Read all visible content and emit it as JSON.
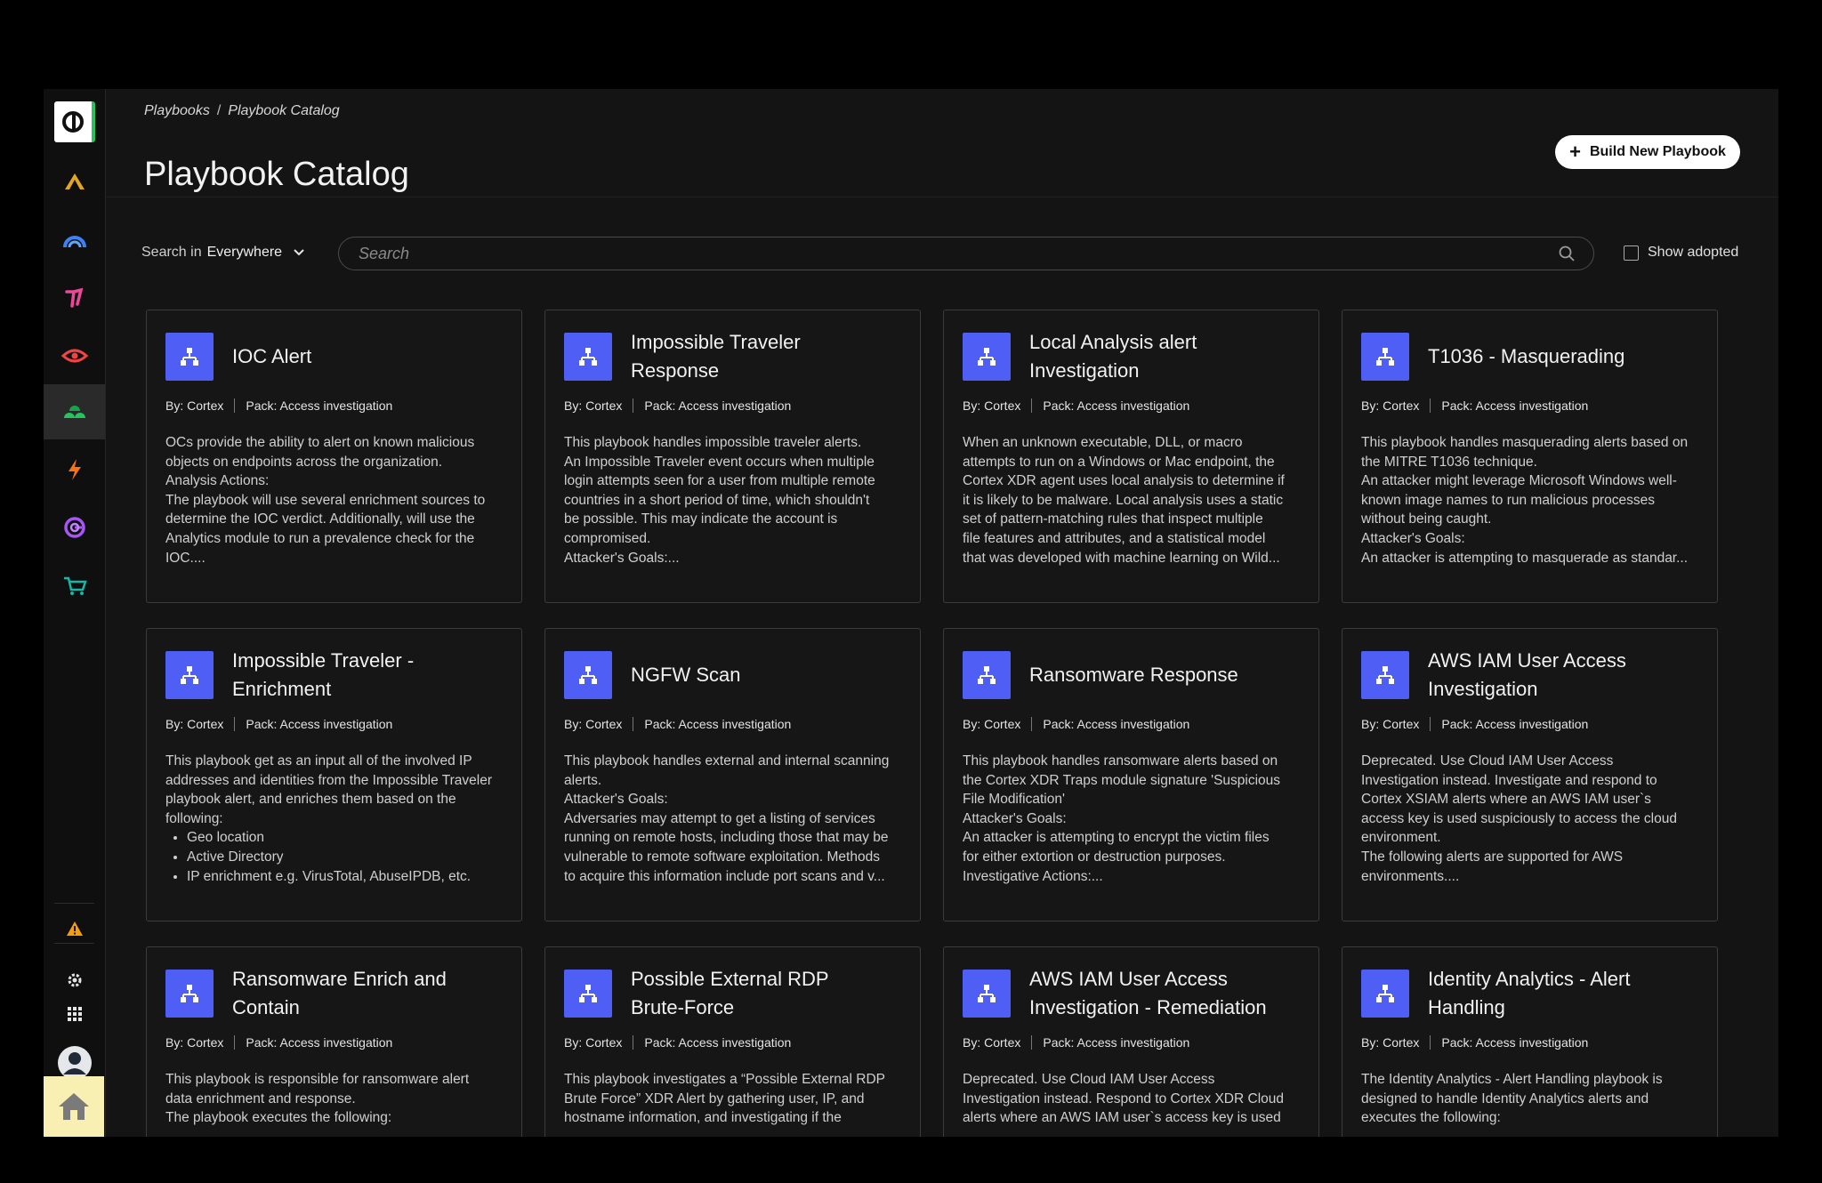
{
  "breadcrumb": {
    "root": "Playbooks",
    "current": "Playbook Catalog"
  },
  "page": {
    "title": "Playbook Catalog",
    "build_label": "Build New Playbook"
  },
  "filter": {
    "search_in_label": "Search in",
    "search_in_value": "Everywhere",
    "search_placeholder": "Search",
    "show_adopted_label": "Show adopted"
  },
  "sidebar": {
    "items": [
      {
        "name": "cortex-logo-icon"
      },
      {
        "name": "triangle-app-icon"
      },
      {
        "name": "dashboard-gauge-icon"
      },
      {
        "name": "signal-app-icon"
      },
      {
        "name": "eye-app-icon"
      },
      {
        "name": "playbooks-app-icon"
      },
      {
        "name": "lightning-app-icon"
      },
      {
        "name": "spiral-app-icon"
      },
      {
        "name": "marketplace-cart-icon"
      },
      {
        "name": "warning-icon"
      },
      {
        "name": "settings-gear-icon"
      },
      {
        "name": "apps-grid-icon"
      },
      {
        "name": "user-avatar-icon"
      },
      {
        "name": "home-icon"
      }
    ]
  },
  "cards": [
    {
      "title": "IOC Alert",
      "by": "By: Cortex",
      "pack": "Pack: Access investigation",
      "desc": "OCs provide the ability to alert on known malicious\nobjects on endpoints across the organization.\nAnalysis Actions:\nThe playbook will use several enrichment sources to\ndetermine the IOC verdict. Additionally, will use the\nAnalytics module to run a prevalence check for the\nIOC...."
    },
    {
      "title": "Impossible Traveler\nResponse",
      "by": "By: Cortex",
      "pack": "Pack: Access investigation",
      "desc": "This playbook handles impossible traveler alerts.\nAn Impossible Traveler event occurs when multiple\nlogin attempts seen for a user from multiple remote\ncountries in a short period of time, which shouldn't\nbe possible. This may indicate the account is\ncompromised.\nAttacker's Goals:..."
    },
    {
      "title": "Local Analysis alert\nInvestigation",
      "by": "By: Cortex",
      "pack": "Pack: Access investigation",
      "desc": "When an unknown executable, DLL, or macro\nattempts to run on a Windows or Mac endpoint, the\nCortex XDR agent uses local analysis to determine if\nit is likely to be malware. Local analysis uses a static\nset of pattern-matching rules that inspect multiple\nfile features and attributes, and a statistical model\nthat was developed with machine learning on Wild..."
    },
    {
      "title": "T1036 - Masquerading",
      "by": "By: Cortex",
      "pack": "Pack: Access investigation",
      "desc": "This playbook handles masquerading alerts based on\nthe MITRE T1036 technique.\nAn attacker might leverage Microsoft Windows well-\nknown image names to run malicious processes\nwithout being caught.\nAttacker's Goals:\nAn attacker is attempting to masquerade as standar..."
    },
    {
      "title": "Impossible Traveler -\nEnrichment",
      "by": "By: Cortex",
      "pack": "Pack: Access investigation",
      "desc": "This playbook get as an input all of the involved IP\naddresses and identities from the Impossible Traveler\nplaybook alert, and enriches them based on the\nfollowing:",
      "bullets": [
        "Geo location",
        "Active Directory",
        "IP enrichment e.g. VirusTotal, AbuseIPDB, etc."
      ]
    },
    {
      "title": "NGFW Scan",
      "by": "By: Cortex",
      "pack": "Pack: Access investigation",
      "desc": "This playbook handles external and internal scanning\nalerts.\nAttacker's Goals:\nAdversaries may attempt to get a listing of services\nrunning on remote hosts, including those that may be\nvulnerable to remote software exploitation. Methods\nto acquire this information include port scans and v..."
    },
    {
      "title": "Ransomware Response",
      "by": "By: Cortex",
      "pack": "Pack: Access investigation",
      "desc": "This playbook handles ransomware alerts based on\nthe Cortex XDR Traps module signature 'Suspicious\nFile Modification'\nAttacker's Goals:\nAn attacker is attempting to encrypt the victim files\nfor either extortion or destruction purposes.\nInvestigative Actions:..."
    },
    {
      "title": "AWS IAM User Access\nInvestigation",
      "by": "By: Cortex",
      "pack": "Pack: Access investigation",
      "desc": "Deprecated. Use Cloud IAM User Access\nInvestigation instead. Investigate and respond to\nCortex XSIAM alerts where an AWS IAM user`s\naccess key is used suspiciously to access the cloud\nenvironment.\nThe following alerts are supported for AWS\nenvironments...."
    },
    {
      "title": "Ransomware Enrich and\nContain",
      "by": "By: Cortex",
      "pack": "Pack: Access investigation",
      "desc": "This playbook is responsible for ransomware alert\ndata enrichment and response.\nThe playbook executes the following:"
    },
    {
      "title": "Possible External RDP\nBrute-Force",
      "by": "By: Cortex",
      "pack": "Pack: Access investigation",
      "desc": "This playbook investigates a “Possible External RDP\nBrute Force” XDR Alert by gathering user, IP, and\nhostname information, and investigating if the"
    },
    {
      "title": "AWS IAM User Access\nInvestigation - Remediation",
      "by": "By: Cortex",
      "pack": "Pack: Access investigation",
      "desc": "Deprecated. Use Cloud IAM User Access\nInvestigation instead. Respond to Cortex XDR Cloud\nalerts where an AWS IAM user`s access key is used"
    },
    {
      "title": "Identity Analytics - Alert\nHandling",
      "by": "By: Cortex",
      "pack": "Pack: Access investigation",
      "desc": "The Identity Analytics - Alert Handling playbook is\ndesigned to handle Identity Analytics alerts and\nexecutes the following:"
    }
  ]
}
